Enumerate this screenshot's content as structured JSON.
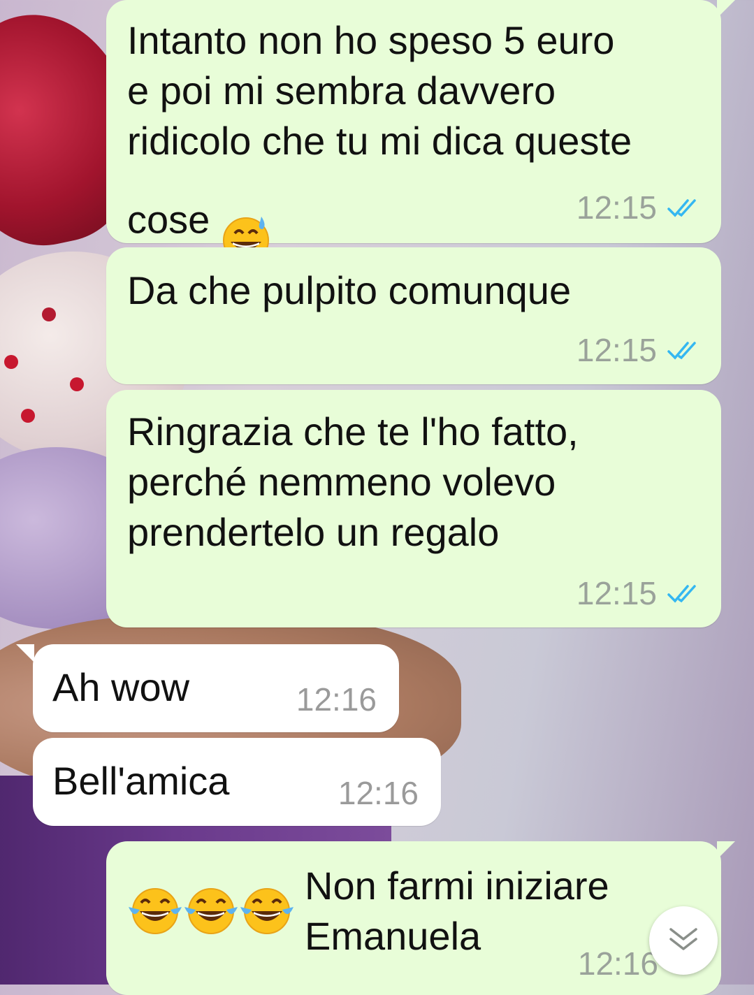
{
  "chat": {
    "messages": [
      {
        "direction": "outgoing",
        "text": "Intanto non ho speso 5 euro\ne poi mi sembra davvero\nridicolo che tu mi dica queste\ncose",
        "emoji": "grinning-sweat-emoji",
        "time": "12:15",
        "status": "read"
      },
      {
        "direction": "outgoing",
        "text": "Da che pulpito comunque",
        "time": "12:15",
        "status": "read"
      },
      {
        "direction": "outgoing",
        "text": "Ringrazia che te l'ho fatto,\nperché nemmeno volevo\nprendertelo un regalo",
        "time": "12:15",
        "status": "read"
      },
      {
        "direction": "incoming",
        "text": "Ah wow",
        "time": "12:16"
      },
      {
        "direction": "incoming",
        "text": "Bell'amica",
        "time": "12:16"
      },
      {
        "direction": "outgoing",
        "leading_emojis": [
          "tears-of-joy-emoji",
          "tears-of-joy-emoji",
          "tears-of-joy-emoji"
        ],
        "text": "Non farmi iniziare\nEmanuela",
        "time": "12:16",
        "status": "read"
      }
    ]
  },
  "scroll_button": {
    "icon": "double-chevron-down-icon"
  },
  "colors": {
    "outgoing_bubble": "#e8fdd8",
    "incoming_bubble": "#ffffff",
    "read_ticks": "#34b7f1",
    "timestamp": "#9aa29a"
  }
}
